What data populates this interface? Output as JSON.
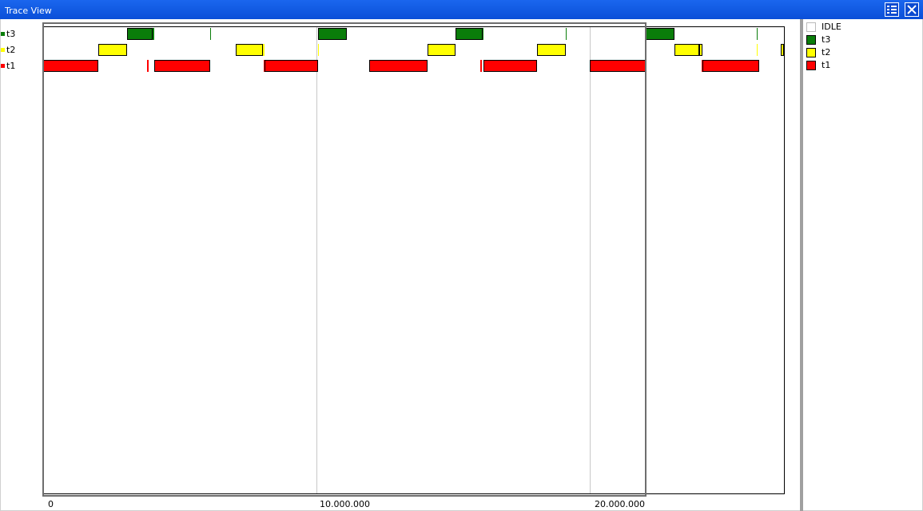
{
  "window": {
    "title": "Trace View"
  },
  "toolbar": {
    "menu_icon": "list-settings-icon",
    "close_icon": "close-icon"
  },
  "rows": [
    {
      "id": "t3",
      "label": "t3",
      "color": "#0a7d0a"
    },
    {
      "id": "t2",
      "label": "t2",
      "color": "#ffff00"
    },
    {
      "id": "t1",
      "label": "t1",
      "color": "#ff0000"
    }
  ],
  "legend": [
    {
      "label": "IDLE",
      "color": "#ffffff"
    },
    {
      "label": "t3",
      "color": "#0a7d0a"
    },
    {
      "label": "t2",
      "color": "#ffff00"
    },
    {
      "label": "t1",
      "color": "#ff0000"
    }
  ],
  "axis": {
    "ticks": [
      {
        "value": 0,
        "label": "0"
      },
      {
        "value": 10000000,
        "label": "10.000.000"
      },
      {
        "value": 20000000,
        "label": "20.000.000"
      }
    ],
    "max": 27100000
  },
  "segments": {
    "t3": [
      [
        3070000,
        4000000
      ],
      [
        4000000,
        4070000
      ],
      [
        6120000,
        6140000
      ],
      [
        10070000,
        11120000
      ],
      [
        15100000,
        16070000
      ],
      [
        16070000,
        16120000
      ],
      [
        19110000,
        19130000
      ],
      [
        22050000,
        23100000
      ],
      [
        26120000,
        26140000
      ]
    ],
    "t2": [
      [
        2030000,
        3070000
      ],
      [
        7040000,
        8050000
      ],
      [
        8050000,
        8100000
      ],
      [
        10050000,
        10070000
      ],
      [
        14060000,
        15100000
      ],
      [
        18070000,
        19110000
      ],
      [
        23100000,
        24000000
      ],
      [
        24000000,
        24130000
      ],
      [
        26100000,
        26120000
      ],
      [
        27000000,
        27100000
      ]
    ],
    "t1": [
      [
        0,
        2030000
      ],
      [
        3800000,
        3850000
      ],
      [
        4070000,
        6120000
      ],
      [
        8070000,
        8100000
      ],
      [
        8100000,
        10050000
      ],
      [
        11940000,
        14060000
      ],
      [
        16000000,
        16050000
      ],
      [
        16120000,
        18070000
      ],
      [
        20000000,
        22050000
      ],
      [
        24100000,
        24130000
      ],
      [
        24130000,
        26200000
      ]
    ]
  }
}
